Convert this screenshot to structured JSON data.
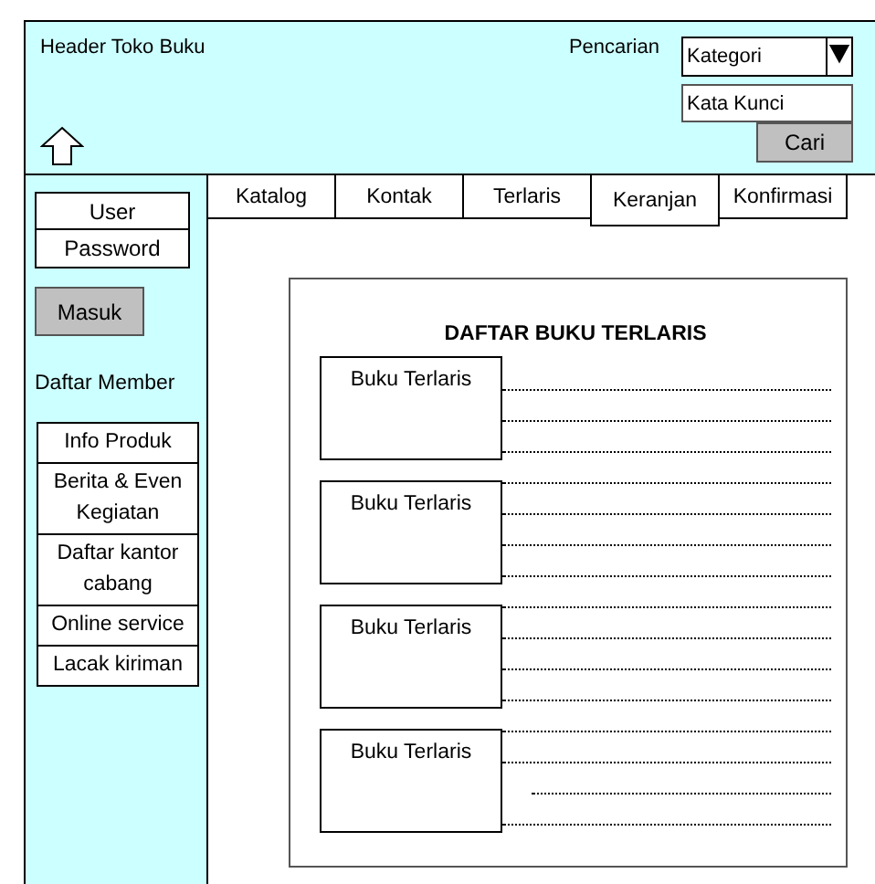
{
  "header": {
    "title": "Header Toko Buku",
    "search_label": "Pencarian",
    "category_select": "Kategori",
    "keyword_field": {
      "placeholder": "Kata Kunci"
    },
    "search_button": "Cari"
  },
  "sidebar": {
    "user_field": {
      "placeholder": "User"
    },
    "password_field": {
      "placeholder": "Password"
    },
    "login_button": "Masuk",
    "register_label": "Daftar Member",
    "menu": [
      "Info Produk",
      "Berita & Even Kegiatan",
      "Daftar kantor cabang",
      "Online service",
      "Lacak kiriman"
    ]
  },
  "tabs": [
    {
      "label": "Katalog",
      "selected": false
    },
    {
      "label": "Kontak",
      "selected": false
    },
    {
      "label": "Terlaris",
      "selected": false
    },
    {
      "label": "Keranjan",
      "selected": true
    },
    {
      "label": "Konfirmasi",
      "selected": false
    }
  ],
  "panel": {
    "title": "DAFTAR BUKU TERLARIS",
    "books": [
      "Buku Terlaris",
      "Buku Terlaris",
      "Buku Terlaris",
      "Buku Terlaris"
    ]
  }
}
